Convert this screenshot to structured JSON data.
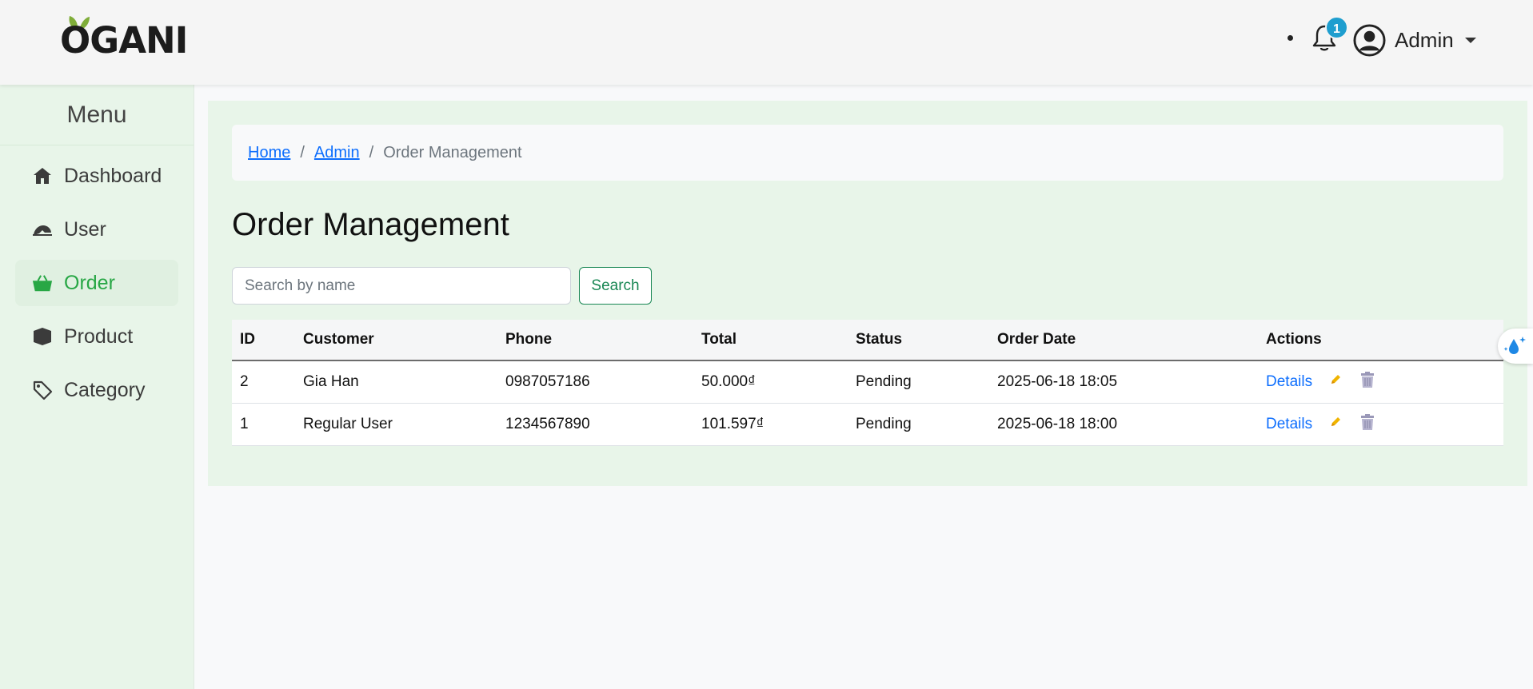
{
  "brand": {
    "logo_text": "OGANI"
  },
  "header": {
    "notification_count": "1",
    "user_name": "Admin"
  },
  "sidebar": {
    "title": "Menu",
    "items": [
      {
        "label": "Dashboard",
        "icon": "home-icon",
        "active": false
      },
      {
        "label": "User",
        "icon": "user-icon",
        "active": false
      },
      {
        "label": "Order",
        "icon": "basket-icon",
        "active": true
      },
      {
        "label": "Product",
        "icon": "box-icon",
        "active": false
      },
      {
        "label": "Category",
        "icon": "tag-icon",
        "active": false
      }
    ]
  },
  "breadcrumb": {
    "home": "Home",
    "admin": "Admin",
    "current": "Order Management",
    "separator": "/"
  },
  "main": {
    "title": "Order Management",
    "search": {
      "placeholder": "Search by name",
      "value": "",
      "button_label": "Search"
    }
  },
  "table": {
    "headers": [
      "ID",
      "Customer",
      "Phone",
      "Total",
      "Status",
      "Order Date",
      "Actions"
    ],
    "rows": [
      {
        "id": "2",
        "customer": "Gia Han",
        "phone": "0987057186",
        "total": "50.000₫",
        "status": "Pending",
        "order_date": "2025-06-18 18:05",
        "details_label": "Details"
      },
      {
        "id": "1",
        "customer": "Regular User",
        "phone": "1234567890",
        "total": "101.597₫",
        "status": "Pending",
        "order_date": "2025-06-18 18:00",
        "details_label": "Details"
      }
    ]
  },
  "colors": {
    "accent_green": "#28a745",
    "sidebar_bg": "#e8f5e9",
    "link_blue": "#0d6efd",
    "badge_blue": "#1e9ecf"
  }
}
